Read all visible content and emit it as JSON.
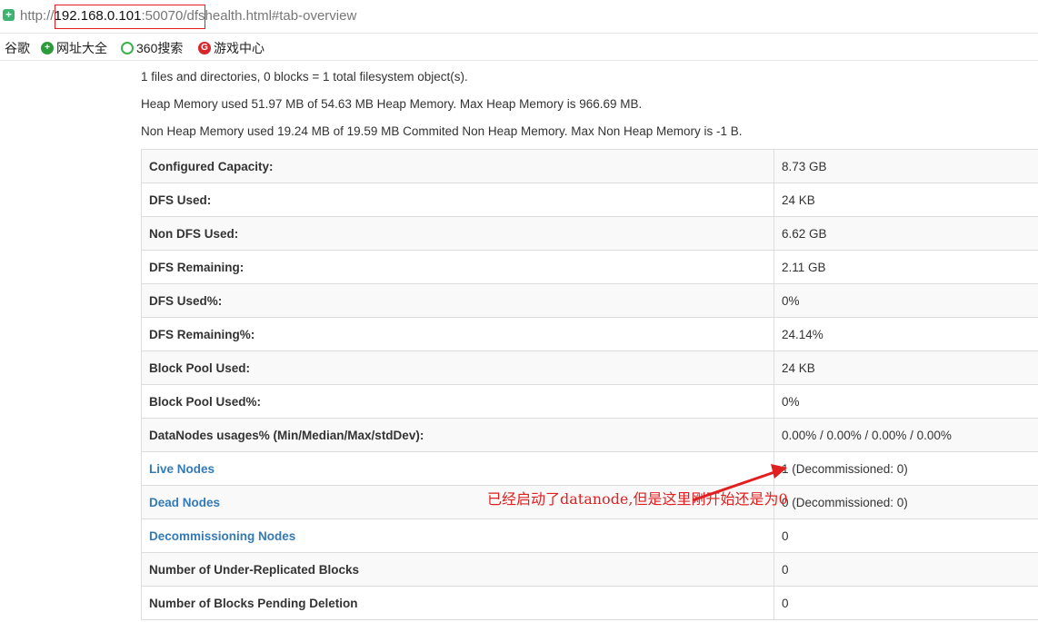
{
  "address_bar": {
    "scheme": "http://",
    "host": "192.168.0.101",
    "sep": ":",
    "port": "50070",
    "path": "/dfshealth.html#tab-overview"
  },
  "bookmarks": [
    {
      "label": "谷歌",
      "icon": "google-icon"
    },
    {
      "label": "网址大全",
      "icon": "plus-circle-icon"
    },
    {
      "label": "360搜索",
      "icon": "360-search-icon"
    },
    {
      "label": "游戏中心",
      "icon": "game-center-icon"
    }
  ],
  "summary": {
    "files": "1 files and directories, 0 blocks = 1 total filesystem object(s).",
    "heap": "Heap Memory used 51.97 MB of 54.63 MB Heap Memory. Max Heap Memory is 966.69 MB.",
    "nonheap": "Non Heap Memory used 19.24 MB of 19.59 MB Commited Non Heap Memory. Max Non Heap Memory is -1 B."
  },
  "overview": [
    {
      "key": "Configured Capacity:",
      "value": "8.73 GB"
    },
    {
      "key": "DFS Used:",
      "value": "24 KB"
    },
    {
      "key": "Non DFS Used:",
      "value": "6.62 GB"
    },
    {
      "key": "DFS Remaining:",
      "value": "2.11 GB"
    },
    {
      "key": "DFS Used%:",
      "value": "0%"
    },
    {
      "key": "DFS Remaining%:",
      "value": "24.14%"
    },
    {
      "key": "Block Pool Used:",
      "value": "24 KB"
    },
    {
      "key": "Block Pool Used%:",
      "value": "0%"
    },
    {
      "key": "DataNodes usages% (Min/Median/Max/stdDev):",
      "value": "0.00% / 0.00% / 0.00% / 0.00%"
    },
    {
      "key": "Live Nodes",
      "value": "1 (Decommissioned: 0)",
      "link": true
    },
    {
      "key": "Dead Nodes",
      "value": "0 (Decommissioned: 0)",
      "link": true
    },
    {
      "key": "Decommissioning Nodes",
      "value": "0",
      "link": true
    },
    {
      "key": "Number of Under-Replicated Blocks",
      "value": "0"
    },
    {
      "key": "Number of Blocks Pending Deletion",
      "value": "0"
    }
  ],
  "annotation": {
    "text": "已经启动了datanode,但是这里刚开始还是为0",
    "color": "#e02020"
  },
  "colors": {
    "link": "#337ab7",
    "highlight": "#e02020"
  }
}
